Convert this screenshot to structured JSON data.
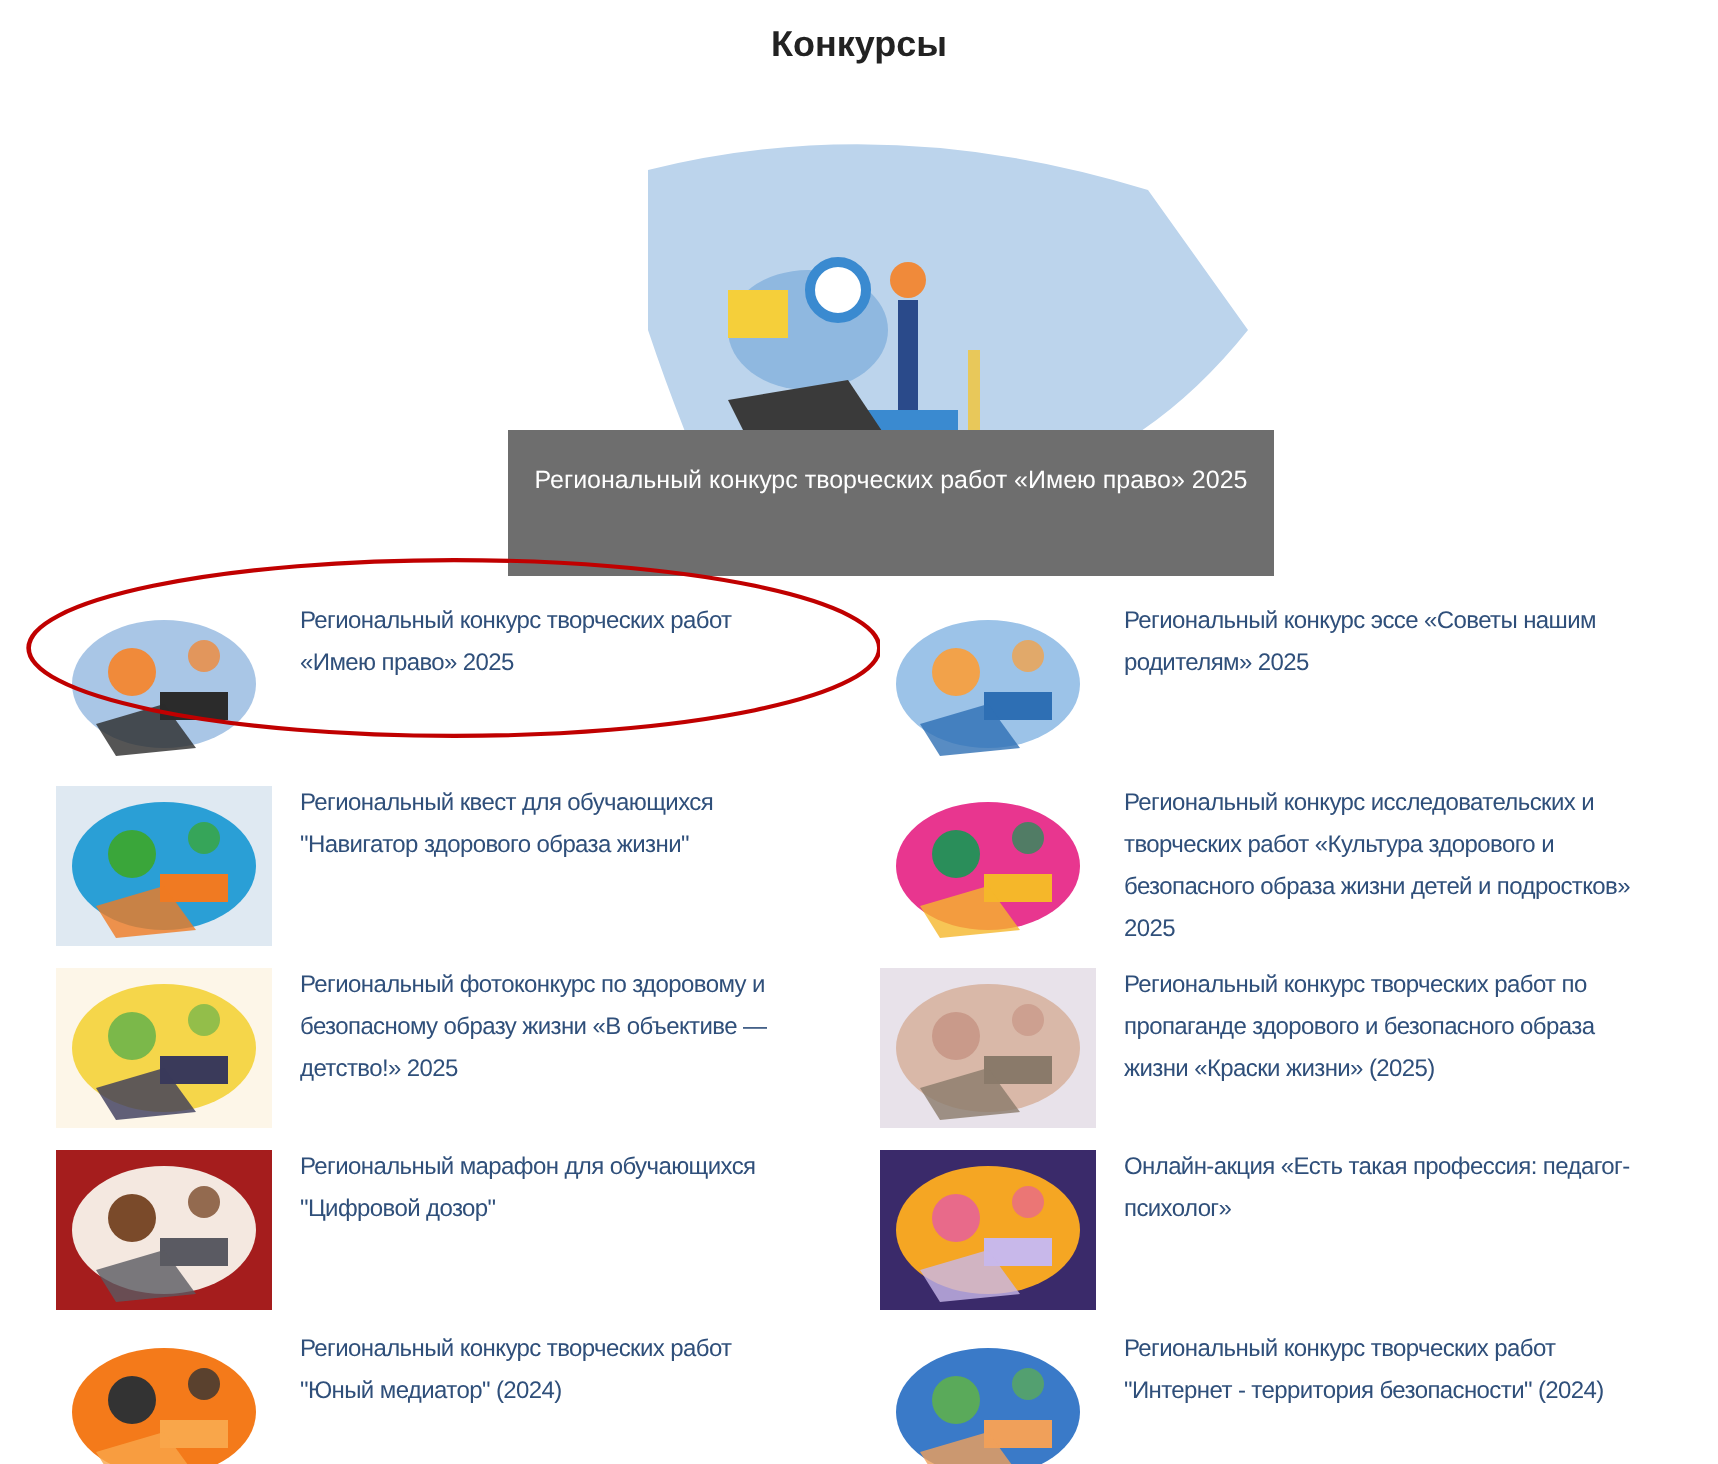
{
  "title": "Конкурсы",
  "featured": {
    "kind": "picture",
    "caption": "Региональный конкурс творческих работ «Имею право» 2025"
  },
  "items": [
    {
      "title": "Региональный конкурс творческих работ «Имею право» 2025",
      "highlighted": true
    },
    {
      "title": "Региональный конкурс эссе «Советы нашим родителям» 2025",
      "highlighted": false
    },
    {
      "title": "Региональный квест для обучающихся \"Навигатор здорового образа жизни\"",
      "highlighted": false
    },
    {
      "title": "Региональный конкурс исследовательских и творческих работ «Культура здорового и безопасного образа жизни детей и подростков» 2025",
      "highlighted": false
    },
    {
      "title": "Региональный фотоконкурс по здоровому и безопасному образу жизни «В объективе — детство!» 2025",
      "highlighted": false
    },
    {
      "title": "Региональный конкурс творческих работ по пропаганде здорового и безопасного образа жизни «Краски жизни» (2025)",
      "highlighted": false
    },
    {
      "title": "Региональный марафон для обучающихся \"Цифровой дозор\"",
      "highlighted": false
    },
    {
      "title": "Онлайн-акция «Есть такая профессия: педагог-психолог»",
      "highlighted": false
    },
    {
      "title": "Региональный конкурс творческих работ \"Юный медиатор\" (2024)",
      "highlighted": false
    },
    {
      "title": "Региональный конкурс творческих работ \"Интернет - территория безопасности\"  (2024)",
      "highlighted": false
    }
  ]
}
